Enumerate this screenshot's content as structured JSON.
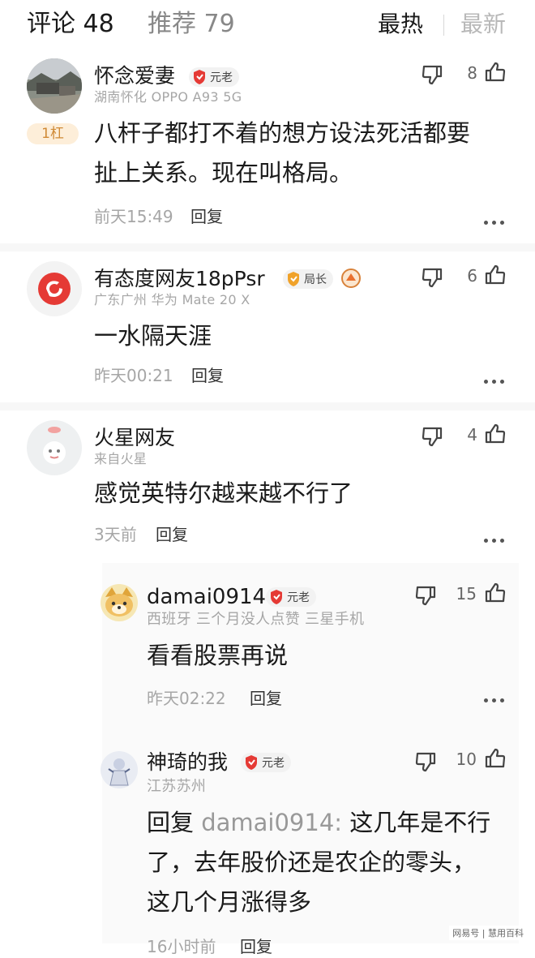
{
  "header": {
    "comments_tab": "评论 48",
    "recommend_tab": "推荐 79",
    "sort_hot": "最热",
    "sort_new": "最新"
  },
  "comments": [
    {
      "username": "怀念爱妻",
      "badge": "元老",
      "meta": "湖南怀化  OPPO A93 5G",
      "hot_tag": "1杠",
      "text": "八杆子都打不着的想方设法死活都要扯上关系。现在叫格局。",
      "time": "前天15:49",
      "reply": "回复",
      "likes": "8"
    },
    {
      "username": "有态度网友18pPsr",
      "badge": "局长",
      "meta": "广东广州  华为 Mate 20 X",
      "text": "一水隔天涯",
      "time": "昨天00:21",
      "reply": "回复",
      "likes": "6"
    },
    {
      "username": "火星网友",
      "meta": "来自火星",
      "text": "感觉英特尔越来越不行了",
      "time": "3天前",
      "reply": "回复",
      "likes": "4"
    }
  ],
  "replies": [
    {
      "username": "damai0914",
      "badge": "元老",
      "meta": "西班牙  三个月没人点赞  三星手机",
      "text": "看看股票再说",
      "time": "昨天02:22",
      "reply": "回复",
      "likes": "15"
    },
    {
      "username": "神琦的我",
      "badge": "元老",
      "meta": "江苏苏州",
      "reply_prefix": "回复 ",
      "quoted_user": "damai0914:",
      "text": " 这几年是不行了，去年股价还是农企的零头，这几个月涨得多",
      "time": "16小时前",
      "reply": "回复",
      "likes": "10"
    }
  ],
  "watermark": "网易号 | 慧用百科",
  "colors": {
    "accent_red": "#e53a35",
    "hot_tag_bg": "#fdeed9",
    "hot_tag_text": "#d08a36",
    "badge_gold": "#f0a22a"
  }
}
